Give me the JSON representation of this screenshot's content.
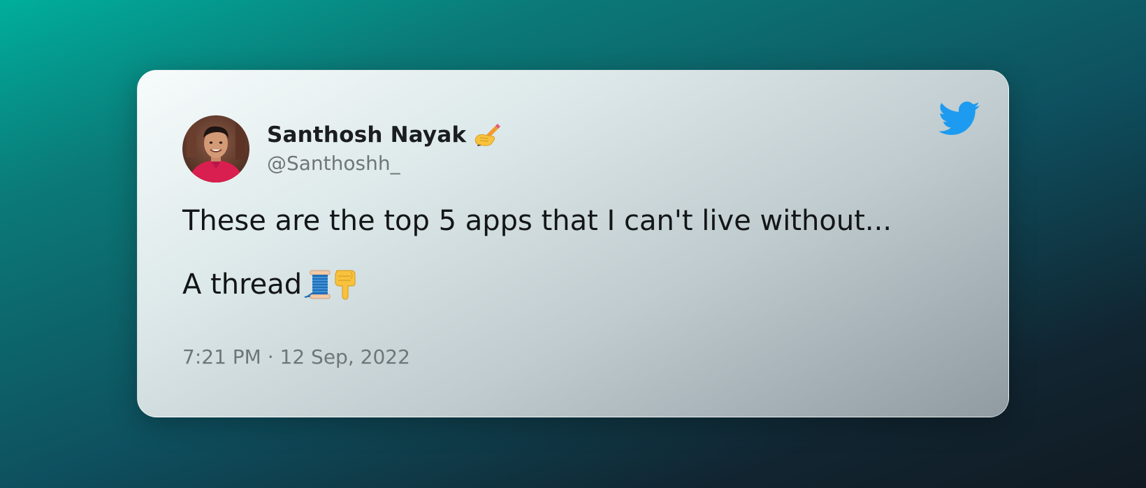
{
  "tweet": {
    "author": {
      "display_name": "Santhosh Nayak",
      "handle": "@Santhoshh_",
      "name_emoji_icon": "writing-hand-emoji",
      "avatar_icon": "profile-photo"
    },
    "text_line_1": "These are the top 5 apps that I can't live without...",
    "text_line_2": "A thread",
    "text_line_2_emojis": [
      "spool-of-thread-emoji",
      "backhand-index-pointing-down-emoji"
    ],
    "timestamp": "7:21 PM · 12 Sep, 2022",
    "brand_icon": "twitter-bird-icon"
  },
  "colors": {
    "twitter_blue": "#1d9bf0",
    "text_primary": "#131517",
    "text_secondary": "#6e7679",
    "background_teal": "#00ae9c",
    "background_dark": "#111a22"
  }
}
